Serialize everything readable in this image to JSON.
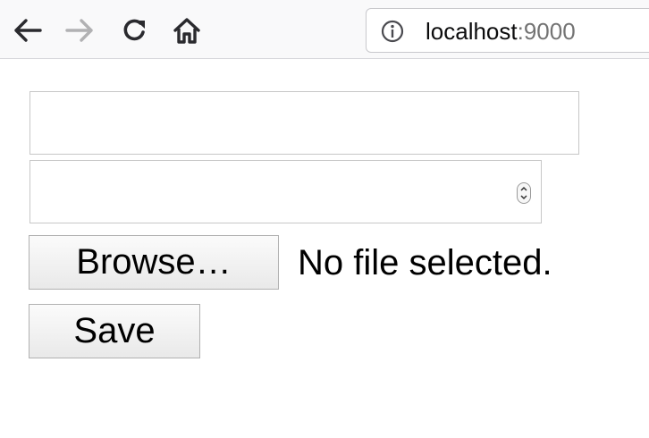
{
  "browser": {
    "url_host": "localhost",
    "url_port": ":9000"
  },
  "icons": {
    "back": "back-arrow-icon",
    "forward": "forward-arrow-icon",
    "reload": "reload-icon",
    "home": "home-icon",
    "info": "info-icon",
    "spinner": "number-spinner-icon"
  },
  "form": {
    "text_value": "",
    "number_value": "",
    "browse_label": "Browse…",
    "file_status": "No file selected.",
    "save_label": "Save"
  }
}
